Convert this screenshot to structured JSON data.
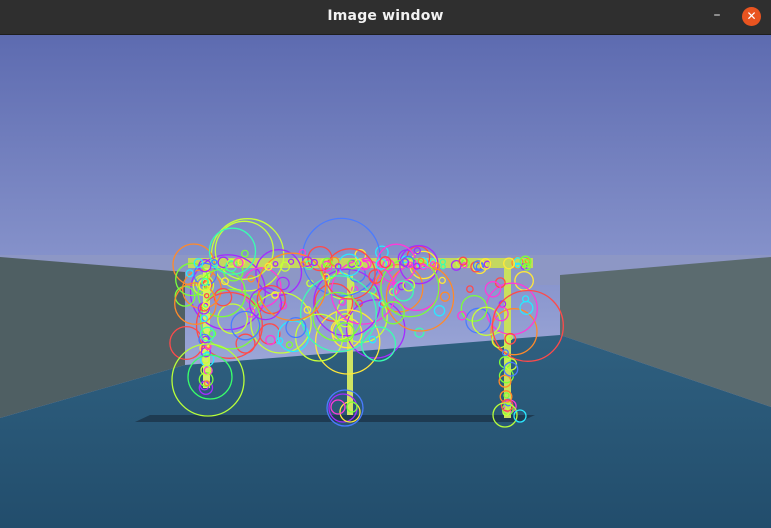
{
  "window": {
    "title": "Image window",
    "minimize_glyph": "–",
    "close_glyph": "✕"
  },
  "scene": {
    "description_colors": {
      "sky_top": "#5f6fb3",
      "sky_bottom": "#b9c3e6",
      "floor": "#2a5878",
      "wall": "#4f5f63",
      "table_legs": "#d8f06a"
    },
    "keypoint_palette": [
      "#7cff3a",
      "#a52bff",
      "#ff4a4a",
      "#2be8ff",
      "#ffe83a",
      "#4a7bff",
      "#ff8a2a",
      "#ff3ad8",
      "#3affb0",
      "#c8ff3a"
    ]
  }
}
